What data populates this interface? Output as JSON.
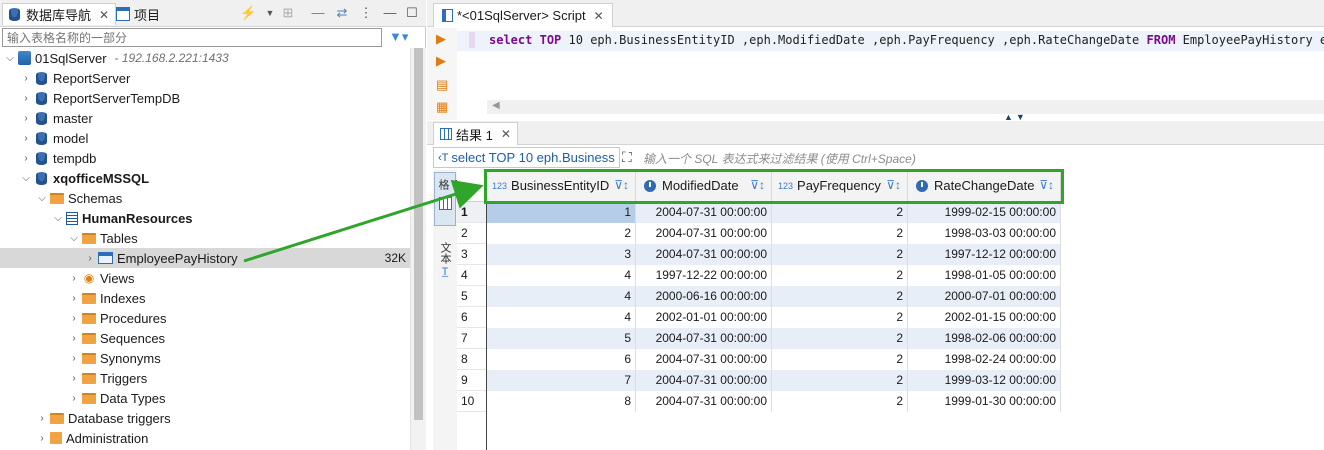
{
  "nav": {
    "tab_db": "数据库导航",
    "tab_project": "项目",
    "filter_placeholder": "输入表格名称的一部分"
  },
  "tree": {
    "server": "01SqlServer",
    "host": "- 192.168.2.221:1433",
    "dbs": [
      "ReportServer",
      "ReportServerTempDB",
      "master",
      "model",
      "tempdb"
    ],
    "active_db": "xqofficeMSSQL",
    "schemas": "Schemas",
    "schema": "HumanResources",
    "tables": "Tables",
    "table": "EmployeePayHistory",
    "table_size": "32K",
    "children": [
      "Views",
      "Indexes",
      "Procedures",
      "Sequences",
      "Synonyms",
      "Triggers",
      "Data Types"
    ],
    "db_triggers": "Database triggers",
    "admin": "Administration"
  },
  "editor": {
    "tab_title": "*<01SqlServer> Script",
    "sql": {
      "k1": "select",
      "k2": "TOP",
      "n": "10",
      "cols": "eph.BusinessEntityID ,eph.ModifiedDate ,eph.PayFrequency ,eph.RateChangeDate",
      "k3": "FROM",
      "tail": "EmployeePayHistory eph"
    }
  },
  "results": {
    "tab_label": "结果 1",
    "query_chip": "select TOP 10 eph.Business",
    "filter_hint": "输入一个 SQL 表达式来过滤结果 (使用 Ctrl+Space)",
    "side_grid": "网格",
    "side_text": "文本",
    "columns": [
      {
        "type": "123",
        "name": "BusinessEntityID"
      },
      {
        "type": "clock",
        "name": "ModifiedDate"
      },
      {
        "type": "123",
        "name": "PayFrequency"
      },
      {
        "type": "clock",
        "name": "RateChangeDate"
      }
    ],
    "rows": [
      [
        "1",
        "1",
        "2004-07-31 00:00:00",
        "2",
        "1999-02-15 00:00:00"
      ],
      [
        "2",
        "2",
        "2004-07-31 00:00:00",
        "2",
        "1998-03-03 00:00:00"
      ],
      [
        "3",
        "3",
        "2004-07-31 00:00:00",
        "2",
        "1997-12-12 00:00:00"
      ],
      [
        "4",
        "4",
        "1997-12-22 00:00:00",
        "2",
        "1998-01-05 00:00:00"
      ],
      [
        "5",
        "4",
        "2000-06-16 00:00:00",
        "2",
        "2000-07-01 00:00:00"
      ],
      [
        "6",
        "4",
        "2002-01-01 00:00:00",
        "2",
        "2002-01-15 00:00:00"
      ],
      [
        "7",
        "5",
        "2004-07-31 00:00:00",
        "2",
        "1998-02-06 00:00:00"
      ],
      [
        "8",
        "6",
        "2004-07-31 00:00:00",
        "2",
        "1998-02-24 00:00:00"
      ],
      [
        "9",
        "7",
        "2004-07-31 00:00:00",
        "2",
        "1999-03-12 00:00:00"
      ],
      [
        "10",
        "8",
        "2004-07-31 00:00:00",
        "2",
        "1999-01-30 00:00:00"
      ]
    ]
  },
  "colors": {
    "highlight": "#2fa52a",
    "keyword": "#7a0b8a",
    "row_alt": "#e8eef8",
    "row_selected": "#b5cde9"
  }
}
